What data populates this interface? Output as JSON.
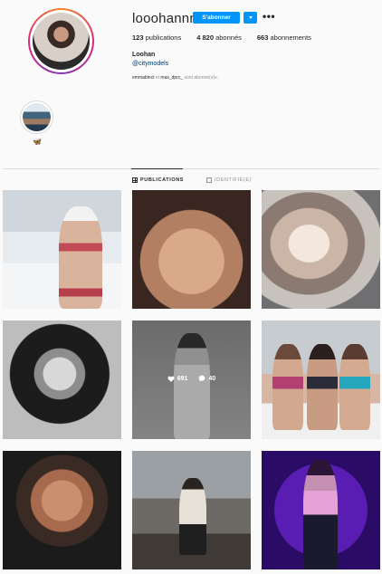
{
  "profile": {
    "username": "looohannn",
    "follow_label": "S'abonner",
    "more_label": "•••",
    "stats": {
      "posts_count": "123",
      "posts_label": "publications",
      "followers_count": "4 820",
      "followers_label": "abonnés",
      "following_count": "663",
      "following_label": "abonnements"
    },
    "full_name": "Loohan",
    "website": "@citymodels",
    "followed_by_users": "emmabinct",
    "followed_by_text_mid": " et ",
    "followed_by_users_2": "max_dprc_",
    "followed_by_text_end": " sont abonné(e)s."
  },
  "highlight": {
    "label": "🦋"
  },
  "tabs": [
    {
      "label": "PUBLICATIONS",
      "icon": "grid-icon",
      "active": true
    },
    {
      "label": "IDENTIFIÉ(E)",
      "icon": "tag-icon",
      "active": false
    }
  ],
  "hover_post": {
    "likes": "691",
    "comments": "40"
  },
  "colors": {
    "accent": "#0095f6",
    "link": "#00376b",
    "background": "#fafafa"
  }
}
